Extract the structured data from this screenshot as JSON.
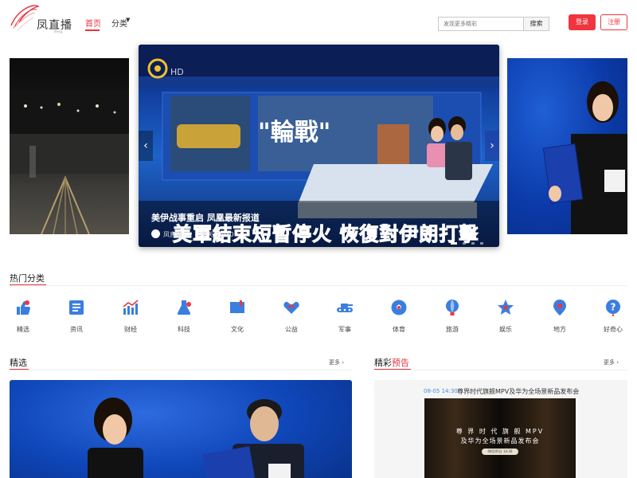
{
  "header": {
    "logo_text": "凤直播",
    "logo_sub": "ifeng",
    "nav_home": "首页",
    "nav_category": "分类",
    "search_placeholder": "发现更多精彩",
    "search_button": "搜索",
    "login": "登录",
    "register": "注册"
  },
  "carousel": {
    "title": "美伊战事重启 凤凰最新报道",
    "source": "凤直播",
    "time": "今天 12:30",
    "subtitle_overlay": "美軍結束短暫停火 恢復對伊朗打擊",
    "screen_banner": "\"輪戰\"",
    "hd_badge": "HD",
    "dots": 4,
    "active_dot": 1
  },
  "hot_categories": {
    "title": "热门分类",
    "items": [
      {
        "label": "精选",
        "icon": "thumbs-up-icon",
        "color": "#3a7ee0"
      },
      {
        "label": "资讯",
        "icon": "news-icon",
        "color": "#3a7ee0"
      },
      {
        "label": "财经",
        "icon": "chart-icon",
        "color": "#3a7ee0"
      },
      {
        "label": "科技",
        "icon": "flask-icon",
        "color": "#3a7ee0"
      },
      {
        "label": "文化",
        "icon": "book-icon",
        "color": "#3a7ee0"
      },
      {
        "label": "公益",
        "icon": "handshake-icon",
        "color": "#3a7ee0"
      },
      {
        "label": "军事",
        "icon": "tank-icon",
        "color": "#3a7ee0"
      },
      {
        "label": "体育",
        "icon": "soccer-icon",
        "color": "#3a7ee0"
      },
      {
        "label": "旅游",
        "icon": "balloon-icon",
        "color": "#3a7ee0"
      },
      {
        "label": "娱乐",
        "icon": "star-icon",
        "color": "#3a7ee0"
      },
      {
        "label": "地方",
        "icon": "map-pin-icon",
        "color": "#3a7ee0"
      },
      {
        "label": "好奇心",
        "icon": "question-icon",
        "color": "#3a7ee0"
      }
    ]
  },
  "featured": {
    "title": "精选",
    "more": "更多 ›"
  },
  "preview": {
    "title_a": "精彩",
    "title_b": "预告",
    "more": "更多 ›",
    "item_time": "08-05 14:30",
    "item_title": "尊界时代旗舰MPV及华为全场景新品发布会",
    "img_title_1": "尊 界 时 代 旗 舰 MPV",
    "img_title_2": "及华为全场景新品发布会",
    "img_pill": "08月05日 14:30"
  },
  "colors": {
    "accent": "#e5333f",
    "icon_blue": "#3a7ee0"
  }
}
